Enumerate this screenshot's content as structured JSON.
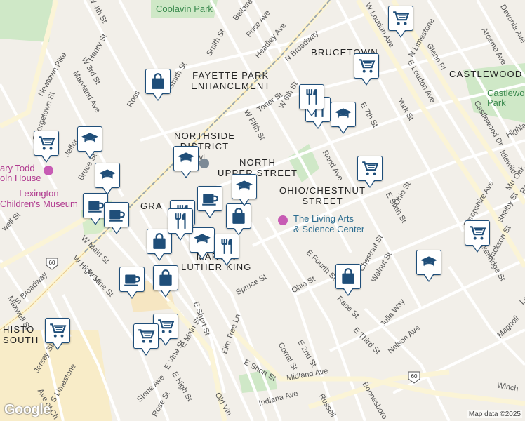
{
  "map": {
    "attribution": "Map data ©2025",
    "logo": "Google",
    "districts": [
      {
        "name": "bucetown",
        "text": "BRUCETOWN"
      },
      {
        "name": "castlewood",
        "text": "CASTLEWOOD"
      },
      {
        "name": "fayette-park",
        "text": "FAYETTE PARK\nENHANCEMENT"
      },
      {
        "name": "northside",
        "text": "NORTHSIDE\nDISTRICT"
      },
      {
        "name": "north-upper",
        "text": "NORTH\nUPPER STREET"
      },
      {
        "name": "ohio-chestnut",
        "text": "OHIO/CHESTNUT\nSTREET"
      },
      {
        "name": "martin-luther-king",
        "text": "MARTIN\nLUTHER KING"
      },
      {
        "name": "gratz",
        "text": "GRA"
      },
      {
        "name": "historic-south",
        "text": "HISTO\nSOUTH"
      }
    ],
    "parks": [
      {
        "name": "coolavin-park",
        "text": "Coolavin Park"
      },
      {
        "name": "castlewood-park",
        "text": "Castlewo\nPark"
      }
    ],
    "pois": [
      {
        "name": "living-arts",
        "text": "The Living Arts\n& Science Center"
      },
      {
        "name": "childrens-museum",
        "text": "Lexington\nChildren's Museum"
      },
      {
        "name": "mary-todd",
        "text": "ary Todd\noln House"
      },
      {
        "name": "transylvania",
        "text": "Transyl\nUniv"
      }
    ],
    "streets": [
      "W 4th St",
      "Bellaire",
      "Price Ave",
      "Headley Ave",
      "Smith St",
      "Henry St",
      "W 3rd St",
      "Newtown Pike",
      "Maryland Ave",
      "Georgetown St",
      "Ross",
      "Smith St",
      "N Broadway",
      "W 6th St",
      "Toner St",
      "W Fifth St",
      "W Loudon Ave",
      "N Limestone",
      "Glenn Pl",
      "Arceme Ave",
      "Devonia Ave",
      "E Loudon Ave",
      "York St",
      "E 7th St",
      "Castlewood Dr",
      "Highla",
      "Idlewild",
      "Oak",
      "Rand Ave",
      "Ohio St",
      "E Sixth St",
      "Shropshire Ave",
      "Shelby St",
      "Breckenridge St",
      "Jackson St",
      "Jeffer",
      "Bruce St",
      "W Main St",
      "W High St",
      "W Vine St",
      "S Broadway",
      "E Short St",
      "E Main St",
      "E Vine St",
      "E High St",
      "Spruce St",
      "Elm Tree Ln",
      "E Fourth St",
      "Ohio St",
      "Race St",
      "Julia Way",
      "Nelson Ave",
      "E Third St",
      "Corral St",
      "E 2nd St",
      "E Short St",
      "Midland Ave",
      "Winch",
      "Indiana Ave",
      "Russell",
      "Boonesboro",
      "Stone Ave",
      "Rose St",
      "Old Vin",
      "Jersey St",
      "S Limestone",
      "Ave of Ch",
      "Maxwell St",
      "well St",
      "Magnoli",
      "Lee",
      "Chestnut St",
      "Walnut St",
      "Mu",
      "Rm"
    ],
    "markers": [
      {
        "type": "cart"
      },
      {
        "type": "cart"
      },
      {
        "type": "cart"
      },
      {
        "type": "cart"
      },
      {
        "type": "cart"
      },
      {
        "type": "cart"
      },
      {
        "type": "cart"
      },
      {
        "type": "cart"
      },
      {
        "type": "bag"
      },
      {
        "type": "bag"
      },
      {
        "type": "bag"
      },
      {
        "type": "bag"
      },
      {
        "type": "bag"
      },
      {
        "type": "cap"
      },
      {
        "type": "cap"
      },
      {
        "type": "cap"
      },
      {
        "type": "cap"
      },
      {
        "type": "cap"
      },
      {
        "type": "cap"
      },
      {
        "type": "cap"
      },
      {
        "type": "dining"
      },
      {
        "type": "dining"
      },
      {
        "type": "dining"
      },
      {
        "type": "dining"
      },
      {
        "type": "dining"
      },
      {
        "type": "cup"
      },
      {
        "type": "cup"
      },
      {
        "type": "cup"
      },
      {
        "type": "cup"
      }
    ]
  }
}
